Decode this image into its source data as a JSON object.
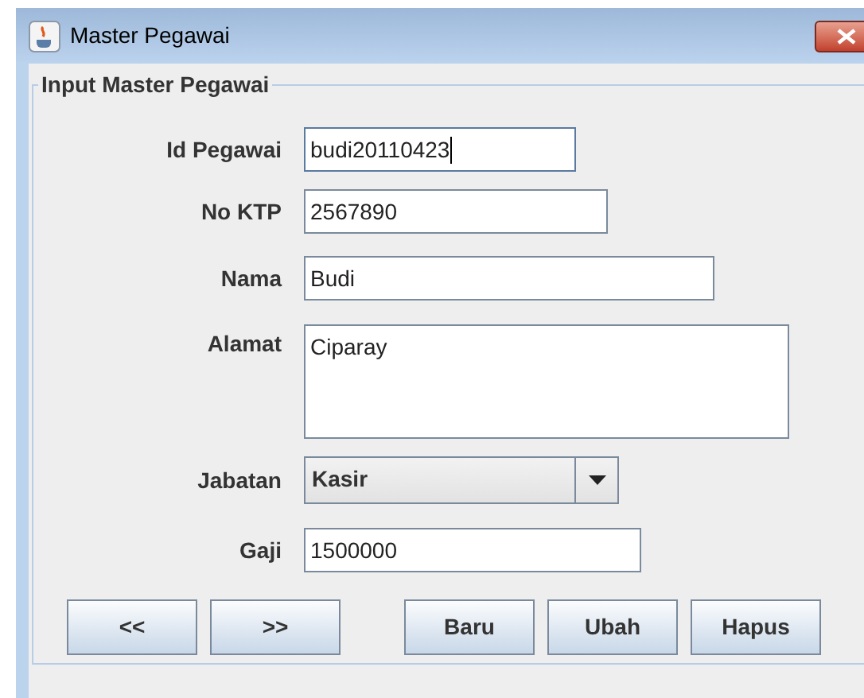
{
  "window": {
    "title": "Master Pegawai"
  },
  "group": {
    "title": "Input Master Pegawai"
  },
  "fields": [
    {
      "kind": "text",
      "label": "Id Pegawai",
      "value": "budi20110423",
      "focused": true
    },
    {
      "kind": "text",
      "label": "No KTP",
      "value": "2567890",
      "focused": false
    },
    {
      "kind": "text",
      "label": "Nama",
      "value": "Budi",
      "focused": false
    },
    {
      "kind": "textarea",
      "label": "Alamat",
      "value": "Ciparay",
      "focused": false
    },
    {
      "kind": "combo",
      "label": "Jabatan",
      "value": "Kasir",
      "focused": false
    },
    {
      "kind": "text",
      "label": "Gaji",
      "value": "1500000",
      "focused": false
    }
  ],
  "buttons": [
    "<<",
    ">>",
    "Baru",
    "Ubah",
    "Hapus"
  ]
}
